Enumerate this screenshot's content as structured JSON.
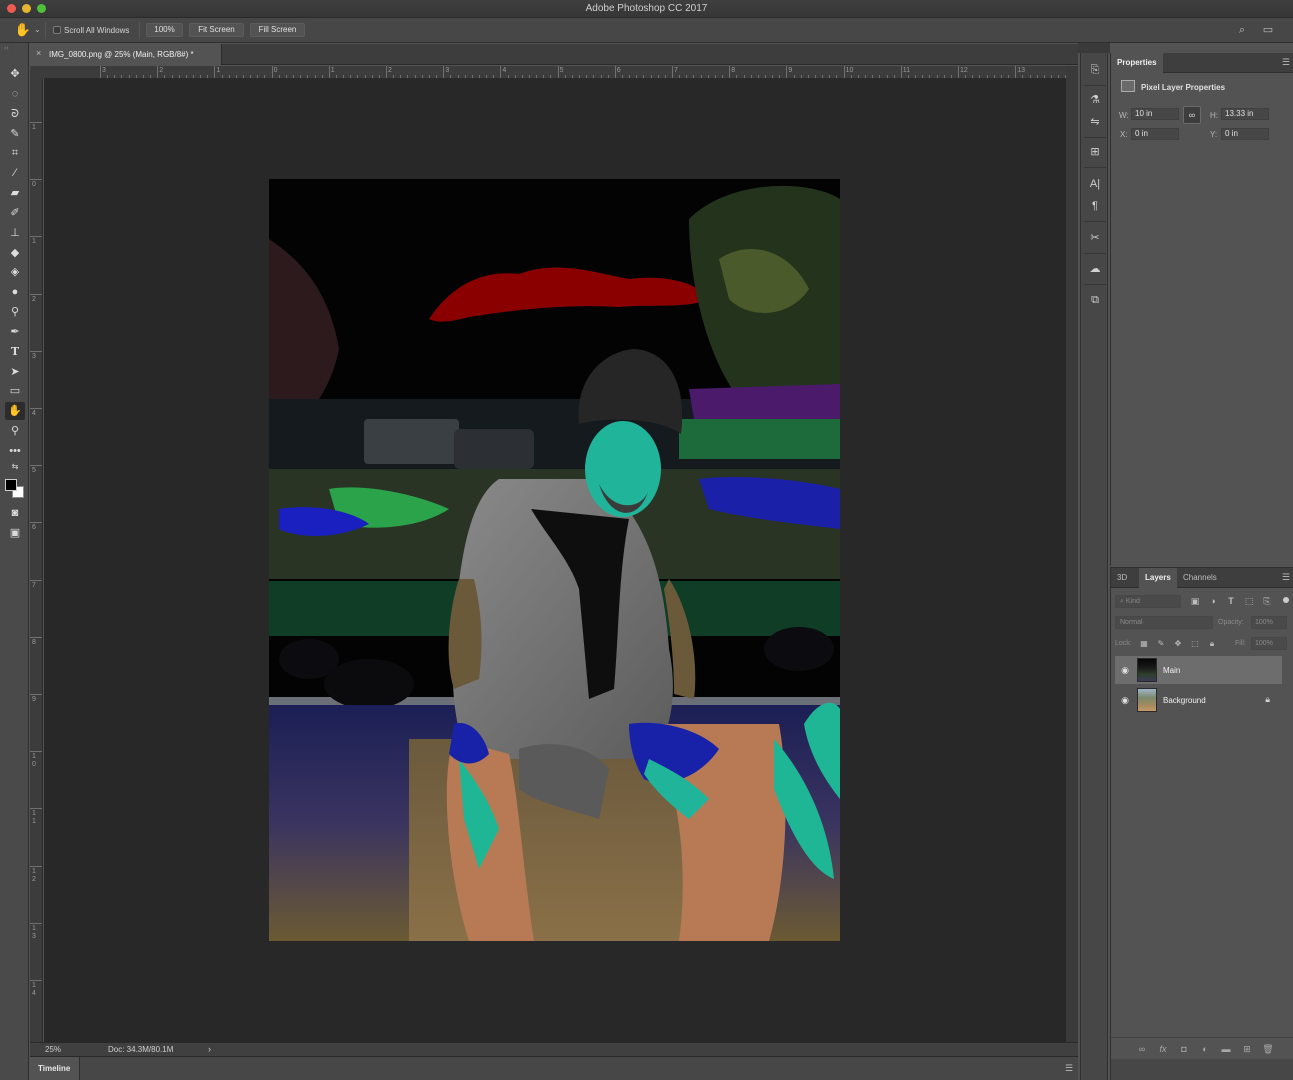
{
  "app": {
    "title": "Adobe Photoshop CC 2017"
  },
  "options_bar": {
    "scroll_all_windows_label": "Scroll All Windows",
    "scroll_all_windows_checked": false,
    "zoom_btn": "100%",
    "fit_screen_btn": "Fit Screen",
    "fill_screen_btn": "Fill Screen"
  },
  "document": {
    "tab_title": "IMG_0800.png @ 25% (Main, RGB/8#) *",
    "ruler_top_labels": [
      "3",
      "2",
      "1",
      "0",
      "1",
      "2",
      "3",
      "4",
      "5",
      "6",
      "7",
      "8",
      "9",
      "10",
      "11",
      "12",
      "13"
    ],
    "ruler_left_labels": [
      "1",
      "0",
      "1",
      "2",
      "3",
      "4",
      "5",
      "6",
      "7",
      "8",
      "9",
      "1\n0",
      "1\n1",
      "1\n2",
      "1\n3",
      "1\n4"
    ]
  },
  "status_bar": {
    "zoom": "25%",
    "doc_size": "Doc: 34.3M/80.1M"
  },
  "timeline": {
    "tab_label": "Timeline"
  },
  "properties": {
    "tab_label": "Properties",
    "section_title": "Pixel Layer Properties",
    "w_label": "W:",
    "w_value": "10 in",
    "h_label": "H:",
    "h_value": "13.33 in",
    "x_label": "X:",
    "x_value": "0 in",
    "y_label": "Y:",
    "y_value": "0 in"
  },
  "layers_panel": {
    "tabs": [
      "3D",
      "Layers",
      "Channels"
    ],
    "active_tab": "Layers",
    "filter_placeholder": "Kind",
    "blend_mode": "Normal",
    "opacity_label": "Opacity:",
    "opacity_value": "100%",
    "lock_label": "Lock:",
    "fill_label": "Fill:",
    "fill_value": "100%",
    "layers": [
      {
        "name": "Main",
        "visible": true,
        "selected": true,
        "locked": false
      },
      {
        "name": "Background",
        "visible": true,
        "selected": false,
        "locked": true
      }
    ]
  },
  "tools": [
    "move-icon",
    "marquee-icon",
    "lasso-icon",
    "quick-select-icon",
    "crop-icon",
    "eyedropper-icon",
    "healing-icon",
    "brush-icon",
    "stamp-icon",
    "eraser-icon",
    "paint-bucket-icon",
    "blur-icon",
    "dodge-icon",
    "pen-icon",
    "type-icon",
    "path-select-icon",
    "rectangle-icon",
    "hand-icon",
    "zoom-icon",
    "more-tools-icon"
  ],
  "colors": {
    "foreground": "#000000",
    "background": "#ffffff",
    "canvas_bg": "#282828",
    "panel_bg": "#535353"
  }
}
